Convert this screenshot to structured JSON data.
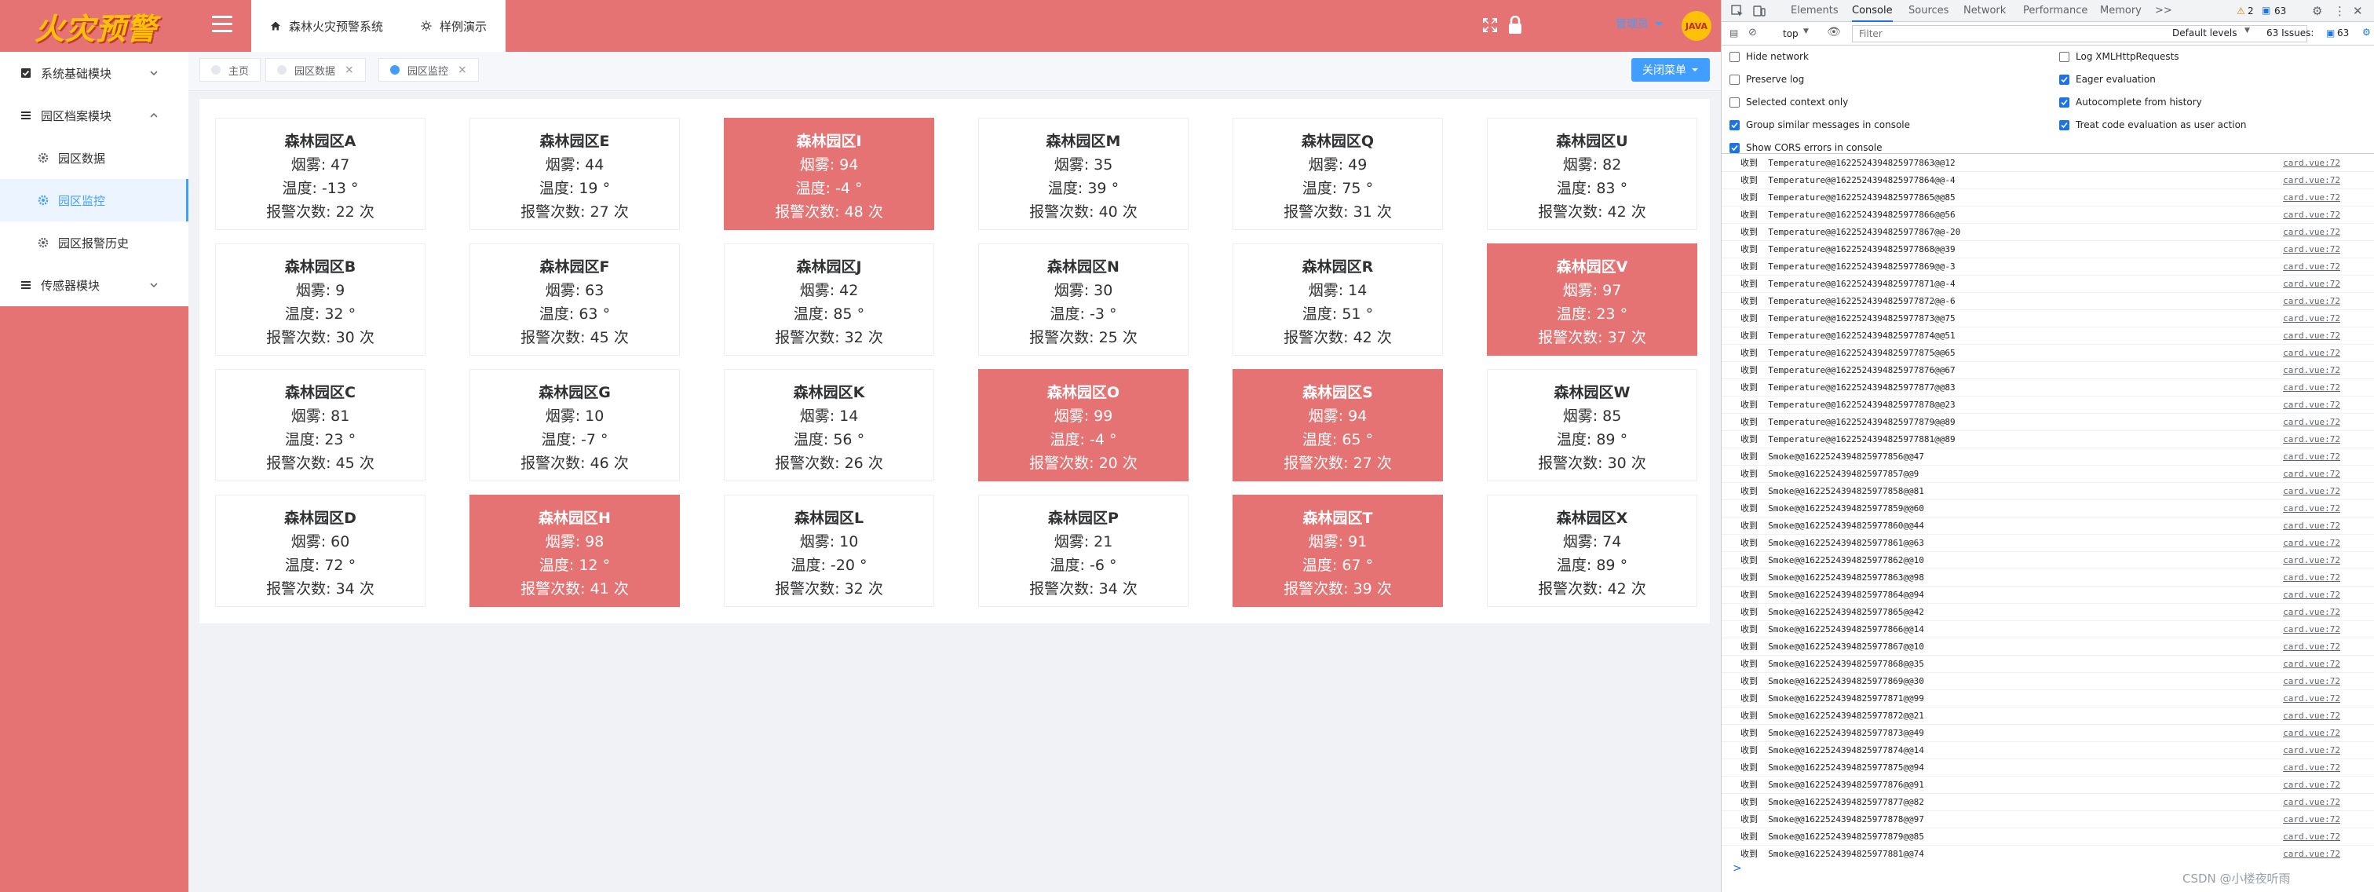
{
  "app": {
    "logo_text": "火灾预警",
    "top_tabs": [
      {
        "label": "森林火灾预警系统"
      },
      {
        "label": "样例演示"
      }
    ],
    "user": "管理员",
    "avatar_text": "JAVA"
  },
  "sidebar": {
    "items": [
      {
        "label": "系统基础模块"
      },
      {
        "label": "园区档案模块"
      },
      {
        "label": "园区数据"
      },
      {
        "label": "园区监控"
      },
      {
        "label": "园区报警历史"
      },
      {
        "label": "传感器模块"
      }
    ]
  },
  "tags": [
    {
      "label": "主页"
    },
    {
      "label": "园区数据",
      "close": "×"
    },
    {
      "label": "园区监控",
      "close": "×"
    }
  ],
  "close_menu_label": "关闭菜单",
  "cards": [
    {
      "title": "森林园区A",
      "smoke": "烟雾: 47",
      "temp": "温度: -13 °",
      "alarms": "报警次数: 22 次",
      "alarm": false
    },
    {
      "title": "森林园区E",
      "smoke": "烟雾: 44",
      "temp": "温度: 19 °",
      "alarms": "报警次数: 27 次",
      "alarm": false
    },
    {
      "title": "森林园区I",
      "smoke": "烟雾: 94",
      "temp": "温度: -4 °",
      "alarms": "报警次数: 48 次",
      "alarm": true
    },
    {
      "title": "森林园区M",
      "smoke": "烟雾: 35",
      "temp": "温度: 39 °",
      "alarms": "报警次数: 40 次",
      "alarm": false
    },
    {
      "title": "森林园区Q",
      "smoke": "烟雾: 49",
      "temp": "温度: 75 °",
      "alarms": "报警次数: 31 次",
      "alarm": false
    },
    {
      "title": "森林园区U",
      "smoke": "烟雾: 82",
      "temp": "温度: 83 °",
      "alarms": "报警次数: 42 次",
      "alarm": false
    },
    {
      "title": "森林园区B",
      "smoke": "烟雾: 9",
      "temp": "温度: 32 °",
      "alarms": "报警次数: 30 次",
      "alarm": false
    },
    {
      "title": "森林园区F",
      "smoke": "烟雾: 63",
      "temp": "温度: 63 °",
      "alarms": "报警次数: 45 次",
      "alarm": false
    },
    {
      "title": "森林园区J",
      "smoke": "烟雾: 42",
      "temp": "温度: 85 °",
      "alarms": "报警次数: 32 次",
      "alarm": false
    },
    {
      "title": "森林园区N",
      "smoke": "烟雾: 30",
      "temp": "温度: -3 °",
      "alarms": "报警次数: 25 次",
      "alarm": false
    },
    {
      "title": "森林园区R",
      "smoke": "烟雾: 14",
      "temp": "温度: 51 °",
      "alarms": "报警次数: 42 次",
      "alarm": false
    },
    {
      "title": "森林园区V",
      "smoke": "烟雾: 97",
      "temp": "温度: 23 °",
      "alarms": "报警次数: 37 次",
      "alarm": true
    },
    {
      "title": "森林园区C",
      "smoke": "烟雾: 81",
      "temp": "温度: 23 °",
      "alarms": "报警次数: 45 次",
      "alarm": false
    },
    {
      "title": "森林园区G",
      "smoke": "烟雾: 10",
      "temp": "温度: -7 °",
      "alarms": "报警次数: 46 次",
      "alarm": false
    },
    {
      "title": "森林园区K",
      "smoke": "烟雾: 14",
      "temp": "温度: 56 °",
      "alarms": "报警次数: 26 次",
      "alarm": false
    },
    {
      "title": "森林园区O",
      "smoke": "烟雾: 99",
      "temp": "温度: -4 °",
      "alarms": "报警次数: 20 次",
      "alarm": true
    },
    {
      "title": "森林园区S",
      "smoke": "烟雾: 94",
      "temp": "温度: 65 °",
      "alarms": "报警次数: 27 次",
      "alarm": true
    },
    {
      "title": "森林园区W",
      "smoke": "烟雾: 85",
      "temp": "温度: 89 °",
      "alarms": "报警次数: 30 次",
      "alarm": false
    },
    {
      "title": "森林园区D",
      "smoke": "烟雾: 60",
      "temp": "温度: 72 °",
      "alarms": "报警次数: 34 次",
      "alarm": false
    },
    {
      "title": "森林园区H",
      "smoke": "烟雾: 98",
      "temp": "温度: 12 °",
      "alarms": "报警次数: 41 次",
      "alarm": true
    },
    {
      "title": "森林园区L",
      "smoke": "烟雾: 10",
      "temp": "温度: -20 °",
      "alarms": "报警次数: 32 次",
      "alarm": false
    },
    {
      "title": "森林园区P",
      "smoke": "烟雾: 21",
      "temp": "温度: -6 °",
      "alarms": "报警次数: 34 次",
      "alarm": false
    },
    {
      "title": "森林园区T",
      "smoke": "烟雾: 91",
      "temp": "温度: 67 °",
      "alarms": "报警次数: 39 次",
      "alarm": true
    },
    {
      "title": "森林园区X",
      "smoke": "烟雾: 74",
      "temp": "温度: 89 °",
      "alarms": "报警次数: 42 次",
      "alarm": false
    }
  ],
  "colors": {
    "header": "#e57373",
    "alarm_card": "#e57373",
    "accent": "#409eff",
    "logo": "#ffc107"
  },
  "devtools": {
    "tabs": [
      "Elements",
      "Console",
      "Sources",
      "Network",
      "Performance",
      "Memory",
      ">>"
    ],
    "warnings": "2",
    "messages": "63",
    "context": "top",
    "filter_placeholder": "Filter",
    "levels": "Default levels",
    "issues": "63 Issues:",
    "issues_count": "63",
    "settings_left": [
      "Hide network",
      "Preserve log",
      "Selected context only",
      "Group similar messages in console",
      "Show CORS errors in console"
    ],
    "settings_right": [
      "Log XMLHttpRequests",
      "Eager evaluation",
      "Autocomplete from history",
      "Treat code evaluation as user action"
    ],
    "log_source": "card.vue:72",
    "logs": [
      "收到  Temperature@@1622524394825977863@@12",
      "收到  Temperature@@1622524394825977864@@-4",
      "收到  Temperature@@1622524394825977865@@85",
      "收到  Temperature@@1622524394825977866@@56",
      "收到  Temperature@@1622524394825977867@@-20",
      "收到  Temperature@@1622524394825977868@@39",
      "收到  Temperature@@1622524394825977869@@-3",
      "收到  Temperature@@1622524394825977871@@-4",
      "收到  Temperature@@1622524394825977872@@-6",
      "收到  Temperature@@1622524394825977873@@75",
      "收到  Temperature@@1622524394825977874@@51",
      "收到  Temperature@@1622524394825977875@@65",
      "收到  Temperature@@1622524394825977876@@67",
      "收到  Temperature@@1622524394825977877@@83",
      "收到  Temperature@@1622524394825977878@@23",
      "收到  Temperature@@1622524394825977879@@89",
      "收到  Temperature@@1622524394825977881@@89",
      "收到  Smoke@@1622524394825977856@@47",
      "收到  Smoke@@1622524394825977857@@9",
      "收到  Smoke@@1622524394825977858@@81",
      "收到  Smoke@@1622524394825977859@@60",
      "收到  Smoke@@1622524394825977860@@44",
      "收到  Smoke@@1622524394825977861@@63",
      "收到  Smoke@@1622524394825977862@@10",
      "收到  Smoke@@1622524394825977863@@98",
      "收到  Smoke@@1622524394825977864@@94",
      "收到  Smoke@@1622524394825977865@@42",
      "收到  Smoke@@1622524394825977866@@14",
      "收到  Smoke@@1622524394825977867@@10",
      "收到  Smoke@@1622524394825977868@@35",
      "收到  Smoke@@1622524394825977869@@30",
      "收到  Smoke@@1622524394825977871@@99",
      "收到  Smoke@@1622524394825977872@@21",
      "收到  Smoke@@1622524394825977873@@49",
      "收到  Smoke@@1622524394825977874@@14",
      "收到  Smoke@@1622524394825977875@@94",
      "收到  Smoke@@1622524394825977876@@91",
      "收到  Smoke@@1622524394825977877@@82",
      "收到  Smoke@@1622524394825977878@@97",
      "收到  Smoke@@1622524394825977879@@85",
      "收到  Smoke@@1622524394825977881@@74"
    ],
    "prompt": ">"
  },
  "watermark": "CSDN @小楼夜听雨"
}
